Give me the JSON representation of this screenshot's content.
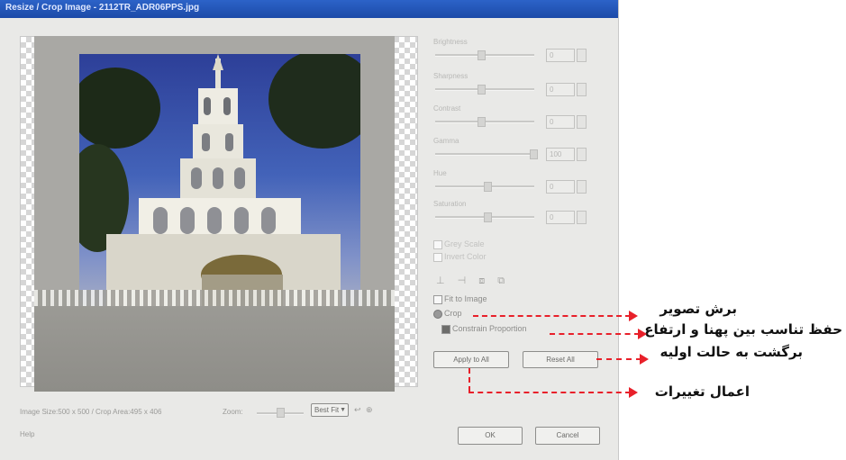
{
  "window": {
    "title": "Resize / Crop Image - 2112TR_ADR06PPS.jpg"
  },
  "panel": {
    "sliders": [
      {
        "label": "Brightness",
        "value": "0"
      },
      {
        "label": "Sharpness",
        "value": "0"
      },
      {
        "label": "Contrast",
        "value": "0"
      },
      {
        "label": "Gamma",
        "value": "100"
      },
      {
        "label": "Hue",
        "value": "0"
      },
      {
        "label": "Saturation",
        "value": "0"
      }
    ],
    "checkboxes": [
      {
        "label": "Grey Scale"
      },
      {
        "label": "Invert Color"
      }
    ],
    "fit_to_image": "Fit to Image",
    "crop_label": "Crop",
    "constrain_label": "Constrain Proportion",
    "apply_button": "Apply to All",
    "reset_button": "Reset All",
    "ok_button": "OK",
    "cancel_button": "Cancel"
  },
  "status": {
    "image_size": "Image Size:500 x 500 / Crop Area:495 x 406",
    "zoom_label": "Zoom:",
    "zoom_value": "Best Fit",
    "help": "Help"
  },
  "annotations": {
    "crop": "برش تصویر",
    "proportion": "حفظ تناسب بین پهنا و ارتفاع",
    "reset": "برگشت به حالت اولیه",
    "apply": "اعمال تغییرات"
  },
  "colors": {
    "arrow": "#e8202a",
    "sky": "#3a58b0"
  }
}
